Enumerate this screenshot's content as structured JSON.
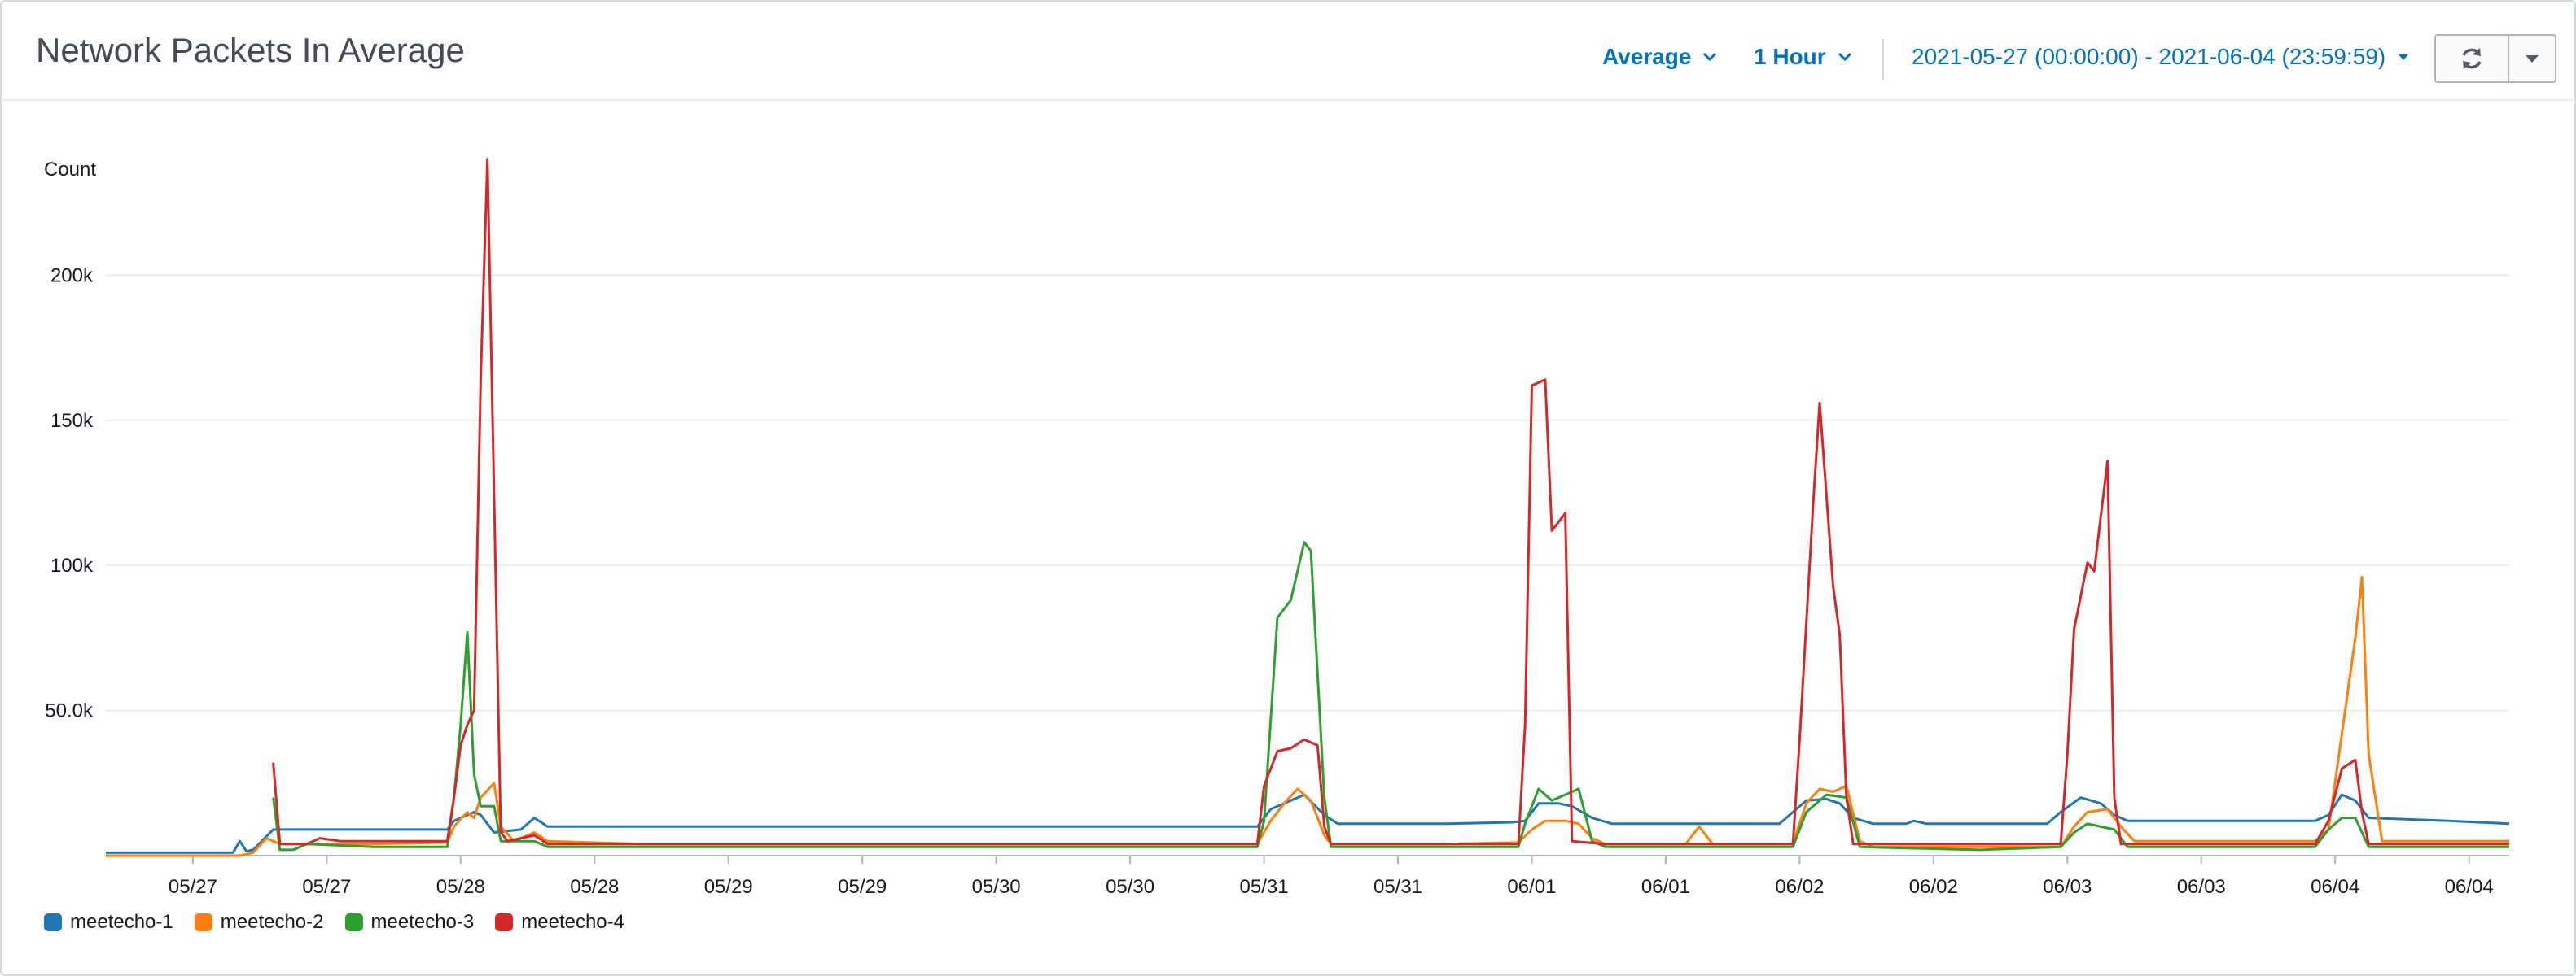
{
  "header": {
    "title": "Network Packets In Average",
    "statistic": "Average",
    "period": "1 Hour",
    "date_range": "2021-05-27 (00:00:00) - 2021-06-04 (23:59:59)"
  },
  "icons": {
    "refresh": "refresh-icon",
    "dropdown": "caret-down-icon",
    "chevron": "chevron-down-icon"
  },
  "chart_data": {
    "type": "line",
    "ylabel": "Count",
    "ylim": [
      0,
      250000
    ],
    "grid": true,
    "legend_position": "bottom-left",
    "y_ticks": [
      {
        "value": 50000,
        "label": "50.0k"
      },
      {
        "value": 100000,
        "label": "100k"
      },
      {
        "value": 150000,
        "label": "150k"
      },
      {
        "value": 200000,
        "label": "200k"
      }
    ],
    "x_range": [
      0,
      215
    ],
    "x_ticks": [
      {
        "hour": 13,
        "label": "05/27"
      },
      {
        "hour": 33,
        "label": "05/27"
      },
      {
        "hour": 53,
        "label": "05/28"
      },
      {
        "hour": 73,
        "label": "05/28"
      },
      {
        "hour": 93,
        "label": "05/29"
      },
      {
        "hour": 113,
        "label": "05/29"
      },
      {
        "hour": 133,
        "label": "05/30"
      },
      {
        "hour": 153,
        "label": "05/30"
      },
      {
        "hour": 173,
        "label": "05/31"
      },
      {
        "hour": 193,
        "label": "05/31"
      },
      {
        "hour": 213,
        "label": "06/01"
      },
      {
        "hour": 233,
        "label": "06/01"
      },
      {
        "hour": 253,
        "label": "06/02"
      },
      {
        "hour": 273,
        "label": "06/02"
      },
      {
        "hour": 293,
        "label": "06/03"
      },
      {
        "hour": 313,
        "label": "06/03"
      },
      {
        "hour": 333,
        "label": "06/04"
      },
      {
        "hour": 353,
        "label": "06/04"
      }
    ],
    "x_unit": "hours since 2021-05-26 00:00 (approx.)",
    "series": [
      {
        "name": "meetecho-1",
        "color": "#1f77b4",
        "points": [
          [
            0,
            1000
          ],
          [
            19,
            1000
          ],
          [
            20,
            5000
          ],
          [
            21,
            1500
          ],
          [
            22,
            2000
          ],
          [
            25,
            9000
          ],
          [
            30,
            9000
          ],
          [
            35,
            9000
          ],
          [
            40,
            9000
          ],
          [
            45,
            9000
          ],
          [
            51,
            9000
          ],
          [
            52,
            12000
          ],
          [
            55,
            15000
          ],
          [
            56,
            14000
          ],
          [
            58,
            8000
          ],
          [
            62,
            9000
          ],
          [
            64,
            13000
          ],
          [
            66,
            10000
          ],
          [
            75,
            10000
          ],
          [
            100,
            10000
          ],
          [
            130,
            10000
          ],
          [
            172,
            10000
          ],
          [
            174,
            16000
          ],
          [
            177,
            19000
          ],
          [
            179,
            21000
          ],
          [
            182,
            14000
          ],
          [
            184,
            11000
          ],
          [
            200,
            11000
          ],
          [
            210,
            11500
          ],
          [
            212,
            12000
          ],
          [
            214,
            18000
          ],
          [
            217,
            18000
          ],
          [
            219,
            17000
          ],
          [
            222,
            13000
          ],
          [
            225,
            11000
          ],
          [
            240,
            11000
          ],
          [
            250,
            11000
          ],
          [
            252,
            15000
          ],
          [
            254,
            19000
          ],
          [
            257,
            19500
          ],
          [
            259,
            18000
          ],
          [
            261,
            13000
          ],
          [
            264,
            11000
          ],
          [
            269,
            11000
          ],
          [
            270,
            12000
          ],
          [
            272,
            11000
          ],
          [
            285,
            11000
          ],
          [
            290,
            11000
          ],
          [
            292,
            15000
          ],
          [
            295,
            20000
          ],
          [
            298,
            18000
          ],
          [
            300,
            14000
          ],
          [
            302,
            12000
          ],
          [
            315,
            12000
          ],
          [
            330,
            12000
          ],
          [
            332,
            14000
          ],
          [
            334,
            21000
          ],
          [
            336,
            19000
          ],
          [
            338,
            13000
          ],
          [
            350,
            12000
          ],
          [
            359,
            11000
          ]
        ]
      },
      {
        "name": "meetecho-2",
        "color": "#ff7f0e",
        "points": [
          [
            0,
            0
          ],
          [
            20,
            0
          ],
          [
            22,
            1000
          ],
          [
            24,
            6000
          ],
          [
            26,
            4000
          ],
          [
            30,
            4000
          ],
          [
            40,
            4000
          ],
          [
            51,
            4500
          ],
          [
            52,
            10000
          ],
          [
            54,
            15000
          ],
          [
            55,
            13000
          ],
          [
            56,
            20000
          ],
          [
            58,
            25000
          ],
          [
            59,
            10000
          ],
          [
            61,
            5000
          ],
          [
            64,
            8000
          ],
          [
            66,
            5000
          ],
          [
            80,
            4000
          ],
          [
            100,
            4000
          ],
          [
            140,
            4000
          ],
          [
            172,
            4000
          ],
          [
            174,
            12000
          ],
          [
            176,
            18000
          ],
          [
            178,
            23000
          ],
          [
            180,
            19000
          ],
          [
            182,
            7000
          ],
          [
            183,
            4000
          ],
          [
            200,
            4000
          ],
          [
            211,
            4500
          ],
          [
            213,
            9000
          ],
          [
            215,
            12000
          ],
          [
            218,
            12000
          ],
          [
            220,
            11000
          ],
          [
            222,
            6000
          ],
          [
            224,
            4000
          ],
          [
            236,
            4000
          ],
          [
            238,
            10000
          ],
          [
            240,
            4000
          ],
          [
            252,
            4000
          ],
          [
            254,
            18000
          ],
          [
            256,
            23000
          ],
          [
            258,
            22000
          ],
          [
            260,
            24000
          ],
          [
            262,
            5000
          ],
          [
            264,
            3000
          ],
          [
            280,
            3000
          ],
          [
            292,
            3000
          ],
          [
            294,
            10000
          ],
          [
            296,
            15000
          ],
          [
            299,
            16000
          ],
          [
            301,
            10000
          ],
          [
            303,
            5000
          ],
          [
            330,
            5000
          ],
          [
            332,
            9000
          ],
          [
            336,
            75000
          ],
          [
            337,
            96000
          ],
          [
            338,
            35000
          ],
          [
            340,
            5000
          ],
          [
            350,
            5000
          ],
          [
            359,
            5000
          ]
        ]
      },
      {
        "name": "meetecho-3",
        "color": "#2ca02c",
        "points": [
          [
            25,
            20000
          ],
          [
            26,
            2000
          ],
          [
            28,
            2000
          ],
          [
            30,
            4000
          ],
          [
            40,
            3000
          ],
          [
            51,
            3000
          ],
          [
            52,
            20000
          ],
          [
            53,
            45000
          ],
          [
            54,
            77000
          ],
          [
            55,
            28000
          ],
          [
            56,
            17000
          ],
          [
            58,
            17000
          ],
          [
            59,
            5000
          ],
          [
            61,
            5000
          ],
          [
            64,
            5000
          ],
          [
            66,
            3000
          ],
          [
            80,
            3000
          ],
          [
            100,
            3000
          ],
          [
            140,
            3000
          ],
          [
            172,
            3000
          ],
          [
            173,
            12000
          ],
          [
            175,
            82000
          ],
          [
            177,
            88000
          ],
          [
            179,
            108000
          ],
          [
            180,
            105000
          ],
          [
            182,
            20000
          ],
          [
            183,
            3000
          ],
          [
            190,
            3000
          ],
          [
            200,
            3000
          ],
          [
            211,
            3000
          ],
          [
            212,
            11000
          ],
          [
            214,
            23000
          ],
          [
            216,
            19000
          ],
          [
            219,
            22000
          ],
          [
            220,
            23000
          ],
          [
            222,
            5000
          ],
          [
            224,
            3000
          ],
          [
            240,
            3000
          ],
          [
            252,
            3000
          ],
          [
            254,
            15000
          ],
          [
            257,
            21000
          ],
          [
            260,
            20000
          ],
          [
            262,
            3000
          ],
          [
            280,
            2000
          ],
          [
            292,
            3000
          ],
          [
            294,
            8000
          ],
          [
            296,
            11000
          ],
          [
            300,
            9000
          ],
          [
            302,
            3000
          ],
          [
            330,
            3000
          ],
          [
            332,
            9000
          ],
          [
            334,
            13000
          ],
          [
            336,
            13000
          ],
          [
            338,
            3000
          ],
          [
            359,
            3000
          ]
        ]
      },
      {
        "name": "meetecho-4",
        "color": "#d62728",
        "points": [
          [
            25,
            32000
          ],
          [
            26,
            4000
          ],
          [
            30,
            4000
          ],
          [
            32,
            6000
          ],
          [
            35,
            5000
          ],
          [
            51,
            5000
          ],
          [
            52,
            20000
          ],
          [
            53,
            38000
          ],
          [
            54,
            45000
          ],
          [
            55,
            50000
          ],
          [
            56,
            165000
          ],
          [
            57,
            240000
          ],
          [
            59,
            8000
          ],
          [
            60,
            5000
          ],
          [
            62,
            6000
          ],
          [
            64,
            7000
          ],
          [
            66,
            4000
          ],
          [
            80,
            4000
          ],
          [
            100,
            4000
          ],
          [
            140,
            4000
          ],
          [
            172,
            4000
          ],
          [
            173,
            24000
          ],
          [
            175,
            36000
          ],
          [
            177,
            37000
          ],
          [
            179,
            40000
          ],
          [
            181,
            38000
          ],
          [
            182,
            10000
          ],
          [
            183,
            4000
          ],
          [
            200,
            4000
          ],
          [
            211,
            4000
          ],
          [
            212,
            45000
          ],
          [
            213,
            162000
          ],
          [
            215,
            164000
          ],
          [
            216,
            112000
          ],
          [
            218,
            118000
          ],
          [
            219,
            5000
          ],
          [
            224,
            4000
          ],
          [
            240,
            4000
          ],
          [
            252,
            4000
          ],
          [
            253,
            40000
          ],
          [
            255,
            120000
          ],
          [
            256,
            156000
          ],
          [
            258,
            93000
          ],
          [
            259,
            76000
          ],
          [
            260,
            20000
          ],
          [
            261,
            4000
          ],
          [
            280,
            4000
          ],
          [
            292,
            4000
          ],
          [
            293,
            35000
          ],
          [
            294,
            78000
          ],
          [
            296,
            101000
          ],
          [
            297,
            98000
          ],
          [
            299,
            136000
          ],
          [
            300,
            20000
          ],
          [
            301,
            4000
          ],
          [
            330,
            4000
          ],
          [
            332,
            12000
          ],
          [
            334,
            30000
          ],
          [
            336,
            33000
          ],
          [
            337,
            15000
          ],
          [
            338,
            4000
          ],
          [
            359,
            4000
          ]
        ]
      }
    ]
  }
}
